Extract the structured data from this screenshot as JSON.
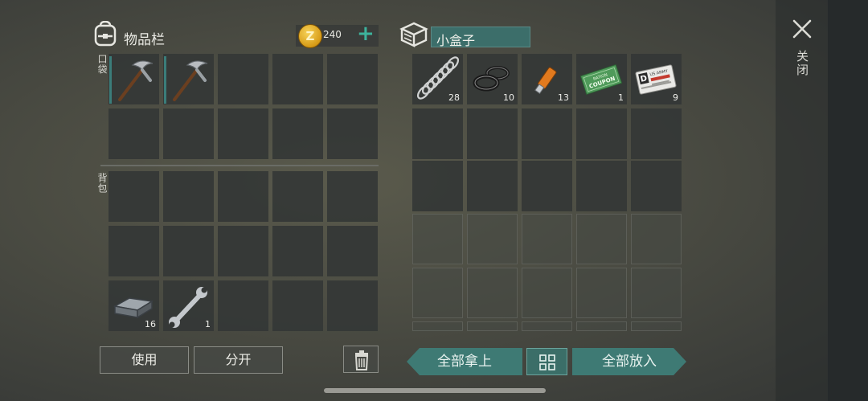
{
  "inventory": {
    "title": "物品栏",
    "coins": "240",
    "coin_symbol": "Z",
    "pocket_label": "口袋",
    "backpack_label": "背包",
    "pocket_items": [
      {
        "name": "pickaxe",
        "count": ""
      },
      {
        "name": "pickaxe",
        "count": ""
      }
    ],
    "backpack_items": [
      {
        "name": "metal-bar",
        "count": "16"
      },
      {
        "name": "wrench",
        "count": "1"
      }
    ]
  },
  "container": {
    "name": "小盒子",
    "items": [
      {
        "name": "spring",
        "count": "28"
      },
      {
        "name": "rubber-rings",
        "count": "10"
      },
      {
        "name": "usb-drive",
        "count": "13"
      },
      {
        "name": "ration-coupon",
        "count": "1",
        "label1": "RATION",
        "label2": "COUPON"
      },
      {
        "name": "id-card",
        "count": "9",
        "letter": "D",
        "label": "US ARMY"
      }
    ]
  },
  "buttons": {
    "use": "使用",
    "split": "分开",
    "take_all": "全部拿上",
    "put_all": "全部放入",
    "close": "关闭"
  },
  "colors": {
    "accent": "#3db39c",
    "teal_button": "#3e7a74",
    "container_field": "#3c6e6a",
    "coin": "#e0a52a"
  }
}
